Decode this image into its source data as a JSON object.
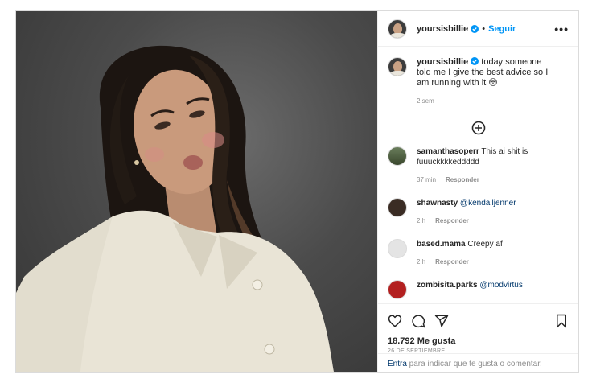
{
  "post": {
    "username": "yoursisbillie",
    "dot": "•",
    "follow_label": "Seguir",
    "more_label": "•••",
    "caption": {
      "username": "yoursisbillie",
      "text": "today someone told me I give the best advice so I am running with it 😳",
      "time": "2 sem"
    },
    "comments": [
      {
        "username": "samanthasoperr",
        "text": "This ai shit is fuuuckkkkeddddd",
        "time": "37 min",
        "reply": "Responder"
      },
      {
        "username": "shawnasty",
        "text": "@kendalljenner",
        "time": "2 h",
        "reply": "Responder"
      },
      {
        "username": "based.mama",
        "text": "Creepy af",
        "time": "2 h",
        "reply": "Responder"
      },
      {
        "username": "zombisita.parks",
        "text": "@modvirtus",
        "time": "",
        "reply": ""
      }
    ],
    "likes": "18.792 Me gusta",
    "date": "26 DE SEPTIEMBRE",
    "add_comment": {
      "login": "Entra",
      "rest": " para indicar que te gusta o comentar."
    }
  },
  "colors": {
    "link_blue": "#0095f6",
    "mention_blue": "#00376b",
    "muted": "#8e8e8e"
  }
}
